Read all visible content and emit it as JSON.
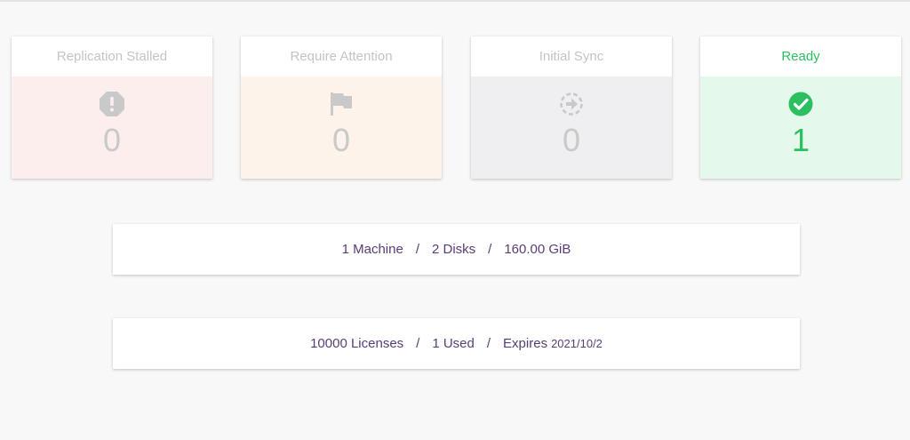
{
  "status_cards": [
    {
      "title": "Replication Stalled",
      "count": "0",
      "icon": "exclamation-octagon-icon"
    },
    {
      "title": "Require Attention",
      "count": "0",
      "icon": "flag-icon"
    },
    {
      "title": "Initial Sync",
      "count": "0",
      "icon": "sync-arrow-circle-icon"
    },
    {
      "title": "Ready",
      "count": "1",
      "icon": "check-circle-icon"
    }
  ],
  "inventory_summary": {
    "machines": "1 Machine",
    "disks": "2 Disks",
    "size": "160.00 GiB",
    "separator": "/"
  },
  "license_summary": {
    "licenses": "10000 Licenses",
    "used": "1 Used",
    "expires_label": "Expires",
    "expires_date": "2021/10/2",
    "separator": "/"
  },
  "colors": {
    "ready_green": "#2cbf5f",
    "muted_gray": "#c9c9c9",
    "summary_purple": "#5a3d78",
    "stalled_bg": "#fdeeee",
    "attention_bg": "#fdf3ea",
    "sync_bg": "#efeff1",
    "ready_bg": "#e4f8ec"
  }
}
